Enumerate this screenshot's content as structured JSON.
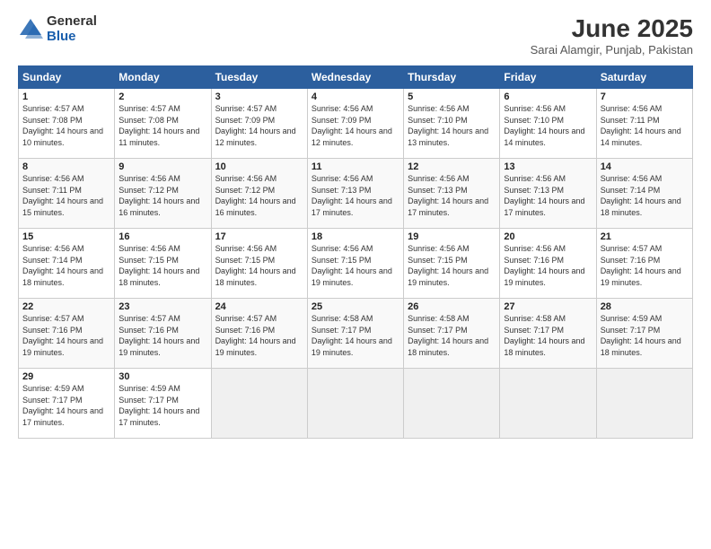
{
  "header": {
    "logo_general": "General",
    "logo_blue": "Blue",
    "month_title": "June 2025",
    "location": "Sarai Alamgir, Punjab, Pakistan"
  },
  "days_of_week": [
    "Sunday",
    "Monday",
    "Tuesday",
    "Wednesday",
    "Thursday",
    "Friday",
    "Saturday"
  ],
  "weeks": [
    [
      {
        "day": "1",
        "sunrise": "4:57 AM",
        "sunset": "7:08 PM",
        "daylight": "14 hours and 10 minutes."
      },
      {
        "day": "2",
        "sunrise": "4:57 AM",
        "sunset": "7:08 PM",
        "daylight": "14 hours and 11 minutes."
      },
      {
        "day": "3",
        "sunrise": "4:57 AM",
        "sunset": "7:09 PM",
        "daylight": "14 hours and 12 minutes."
      },
      {
        "day": "4",
        "sunrise": "4:56 AM",
        "sunset": "7:09 PM",
        "daylight": "14 hours and 12 minutes."
      },
      {
        "day": "5",
        "sunrise": "4:56 AM",
        "sunset": "7:10 PM",
        "daylight": "14 hours and 13 minutes."
      },
      {
        "day": "6",
        "sunrise": "4:56 AM",
        "sunset": "7:10 PM",
        "daylight": "14 hours and 14 minutes."
      },
      {
        "day": "7",
        "sunrise": "4:56 AM",
        "sunset": "7:11 PM",
        "daylight": "14 hours and 14 minutes."
      }
    ],
    [
      {
        "day": "8",
        "sunrise": "4:56 AM",
        "sunset": "7:11 PM",
        "daylight": "14 hours and 15 minutes."
      },
      {
        "day": "9",
        "sunrise": "4:56 AM",
        "sunset": "7:12 PM",
        "daylight": "14 hours and 16 minutes."
      },
      {
        "day": "10",
        "sunrise": "4:56 AM",
        "sunset": "7:12 PM",
        "daylight": "14 hours and 16 minutes."
      },
      {
        "day": "11",
        "sunrise": "4:56 AM",
        "sunset": "7:13 PM",
        "daylight": "14 hours and 17 minutes."
      },
      {
        "day": "12",
        "sunrise": "4:56 AM",
        "sunset": "7:13 PM",
        "daylight": "14 hours and 17 minutes."
      },
      {
        "day": "13",
        "sunrise": "4:56 AM",
        "sunset": "7:13 PM",
        "daylight": "14 hours and 17 minutes."
      },
      {
        "day": "14",
        "sunrise": "4:56 AM",
        "sunset": "7:14 PM",
        "daylight": "14 hours and 18 minutes."
      }
    ],
    [
      {
        "day": "15",
        "sunrise": "4:56 AM",
        "sunset": "7:14 PM",
        "daylight": "14 hours and 18 minutes."
      },
      {
        "day": "16",
        "sunrise": "4:56 AM",
        "sunset": "7:15 PM",
        "daylight": "14 hours and 18 minutes."
      },
      {
        "day": "17",
        "sunrise": "4:56 AM",
        "sunset": "7:15 PM",
        "daylight": "14 hours and 18 minutes."
      },
      {
        "day": "18",
        "sunrise": "4:56 AM",
        "sunset": "7:15 PM",
        "daylight": "14 hours and 19 minutes."
      },
      {
        "day": "19",
        "sunrise": "4:56 AM",
        "sunset": "7:15 PM",
        "daylight": "14 hours and 19 minutes."
      },
      {
        "day": "20",
        "sunrise": "4:56 AM",
        "sunset": "7:16 PM",
        "daylight": "14 hours and 19 minutes."
      },
      {
        "day": "21",
        "sunrise": "4:57 AM",
        "sunset": "7:16 PM",
        "daylight": "14 hours and 19 minutes."
      }
    ],
    [
      {
        "day": "22",
        "sunrise": "4:57 AM",
        "sunset": "7:16 PM",
        "daylight": "14 hours and 19 minutes."
      },
      {
        "day": "23",
        "sunrise": "4:57 AM",
        "sunset": "7:16 PM",
        "daylight": "14 hours and 19 minutes."
      },
      {
        "day": "24",
        "sunrise": "4:57 AM",
        "sunset": "7:16 PM",
        "daylight": "14 hours and 19 minutes."
      },
      {
        "day": "25",
        "sunrise": "4:58 AM",
        "sunset": "7:17 PM",
        "daylight": "14 hours and 19 minutes."
      },
      {
        "day": "26",
        "sunrise": "4:58 AM",
        "sunset": "7:17 PM",
        "daylight": "14 hours and 18 minutes."
      },
      {
        "day": "27",
        "sunrise": "4:58 AM",
        "sunset": "7:17 PM",
        "daylight": "14 hours and 18 minutes."
      },
      {
        "day": "28",
        "sunrise": "4:59 AM",
        "sunset": "7:17 PM",
        "daylight": "14 hours and 18 minutes."
      }
    ],
    [
      {
        "day": "29",
        "sunrise": "4:59 AM",
        "sunset": "7:17 PM",
        "daylight": "14 hours and 17 minutes."
      },
      {
        "day": "30",
        "sunrise": "4:59 AM",
        "sunset": "7:17 PM",
        "daylight": "14 hours and 17 minutes."
      },
      null,
      null,
      null,
      null,
      null
    ]
  ]
}
